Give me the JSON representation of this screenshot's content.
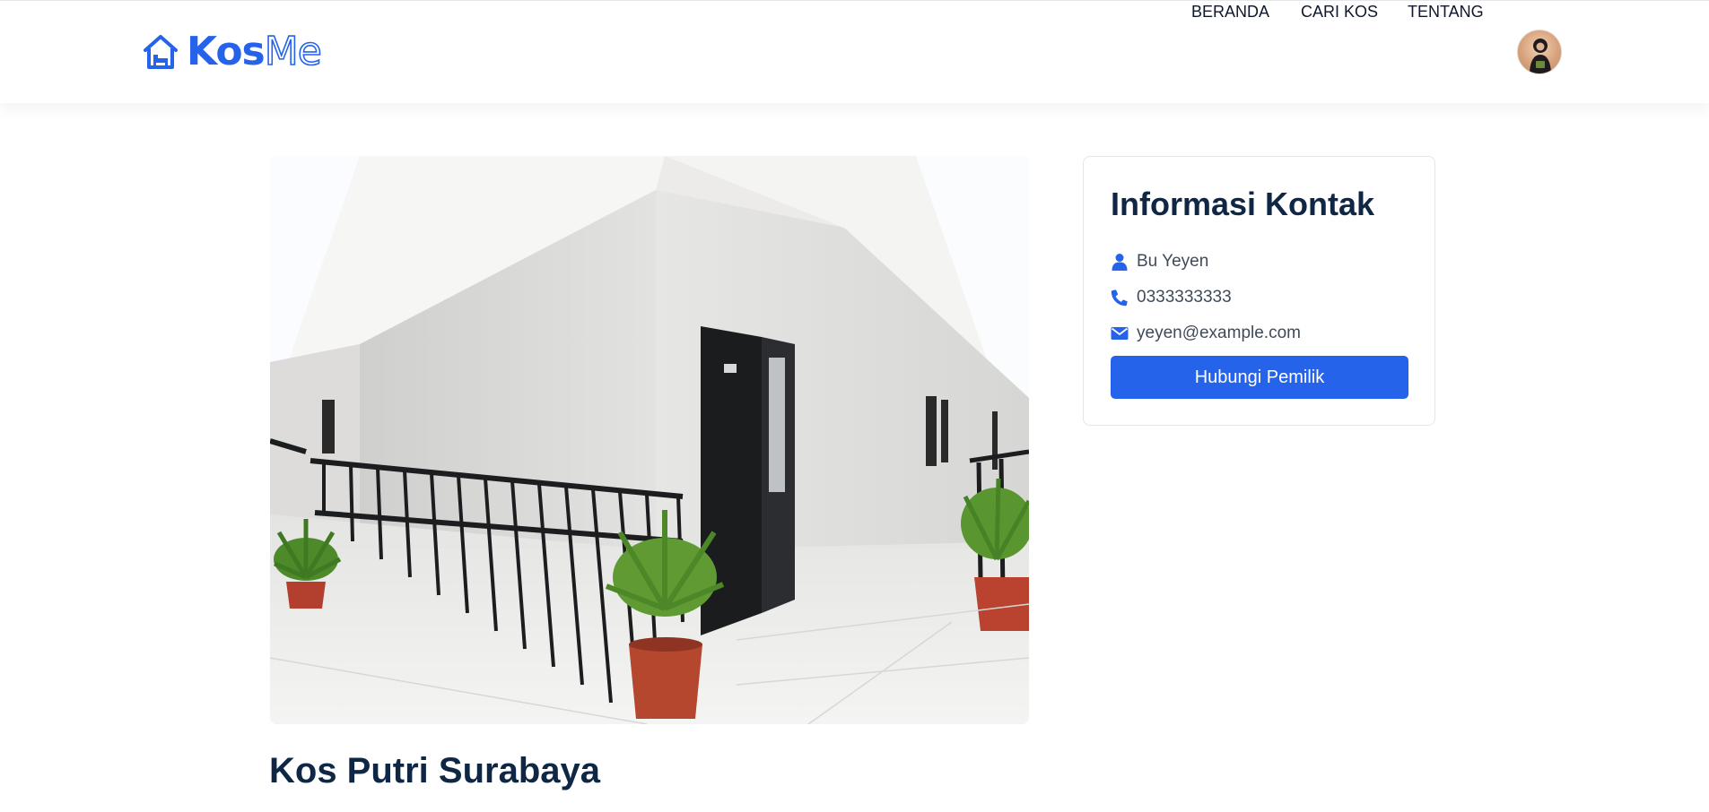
{
  "brand": {
    "logo_icon": "house-bed-icon",
    "name_part_1": "Kos",
    "name_part_2": "Me",
    "accent_color": "#2563eb"
  },
  "nav": {
    "items": [
      {
        "label": "BERANDA"
      },
      {
        "label": "CARI KOS"
      },
      {
        "label": "TENTANG"
      }
    ],
    "avatar_icon": "user-avatar"
  },
  "listing": {
    "title": "Kos Putri Surabaya",
    "image_icon": "boarding-house-corridor-photo"
  },
  "contact": {
    "title": "Informasi Kontak",
    "owner_name": "Bu Yeyen",
    "phone": "0333333333",
    "email": "yeyen@example.com",
    "button_label": "Hubungi Pemilik",
    "icons": {
      "person": "user-icon",
      "phone": "phone-icon",
      "email": "envelope-icon"
    }
  }
}
